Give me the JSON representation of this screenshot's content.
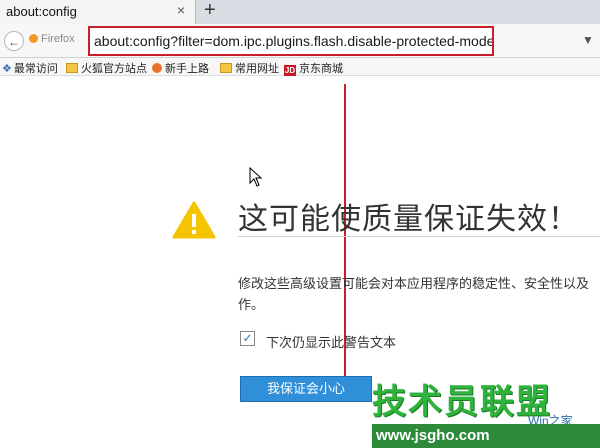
{
  "tab": {
    "title": "about:config",
    "close": "×",
    "new_tab": "+"
  },
  "navbar": {
    "back": "←",
    "identity": "Firefox",
    "url": "about:config?filter=dom.ipc.plugins.flash.disable-protected-mode",
    "dropdown": "▼"
  },
  "bookmarks": [
    {
      "label": "最常访问",
      "icon": "star-icon"
    },
    {
      "label": "火狐官方站点",
      "icon": "folder-icon"
    },
    {
      "label": "新手上路",
      "icon": "firefox-icon"
    },
    {
      "label": "常用网址",
      "icon": "folder-icon"
    },
    {
      "label": "京东商城",
      "icon": "jd-icon"
    }
  ],
  "warning": {
    "title": "这可能使质量保证失效！",
    "description": "修改这些高级设置可能会对本应用程序的稳定性、安全性以及",
    "description_cont": "作。",
    "checkbox_label": "下次仍显示此警告文本",
    "checkbox_checked": true,
    "accept_button": "我保证会小心"
  },
  "watermark": {
    "brand": "技术员联盟",
    "sub": "Win之家",
    "url": "www.jsgho.com"
  },
  "colors": {
    "annotation": "#c8202a",
    "button": "#2f8fd8",
    "watermark": "#2fb33c"
  }
}
